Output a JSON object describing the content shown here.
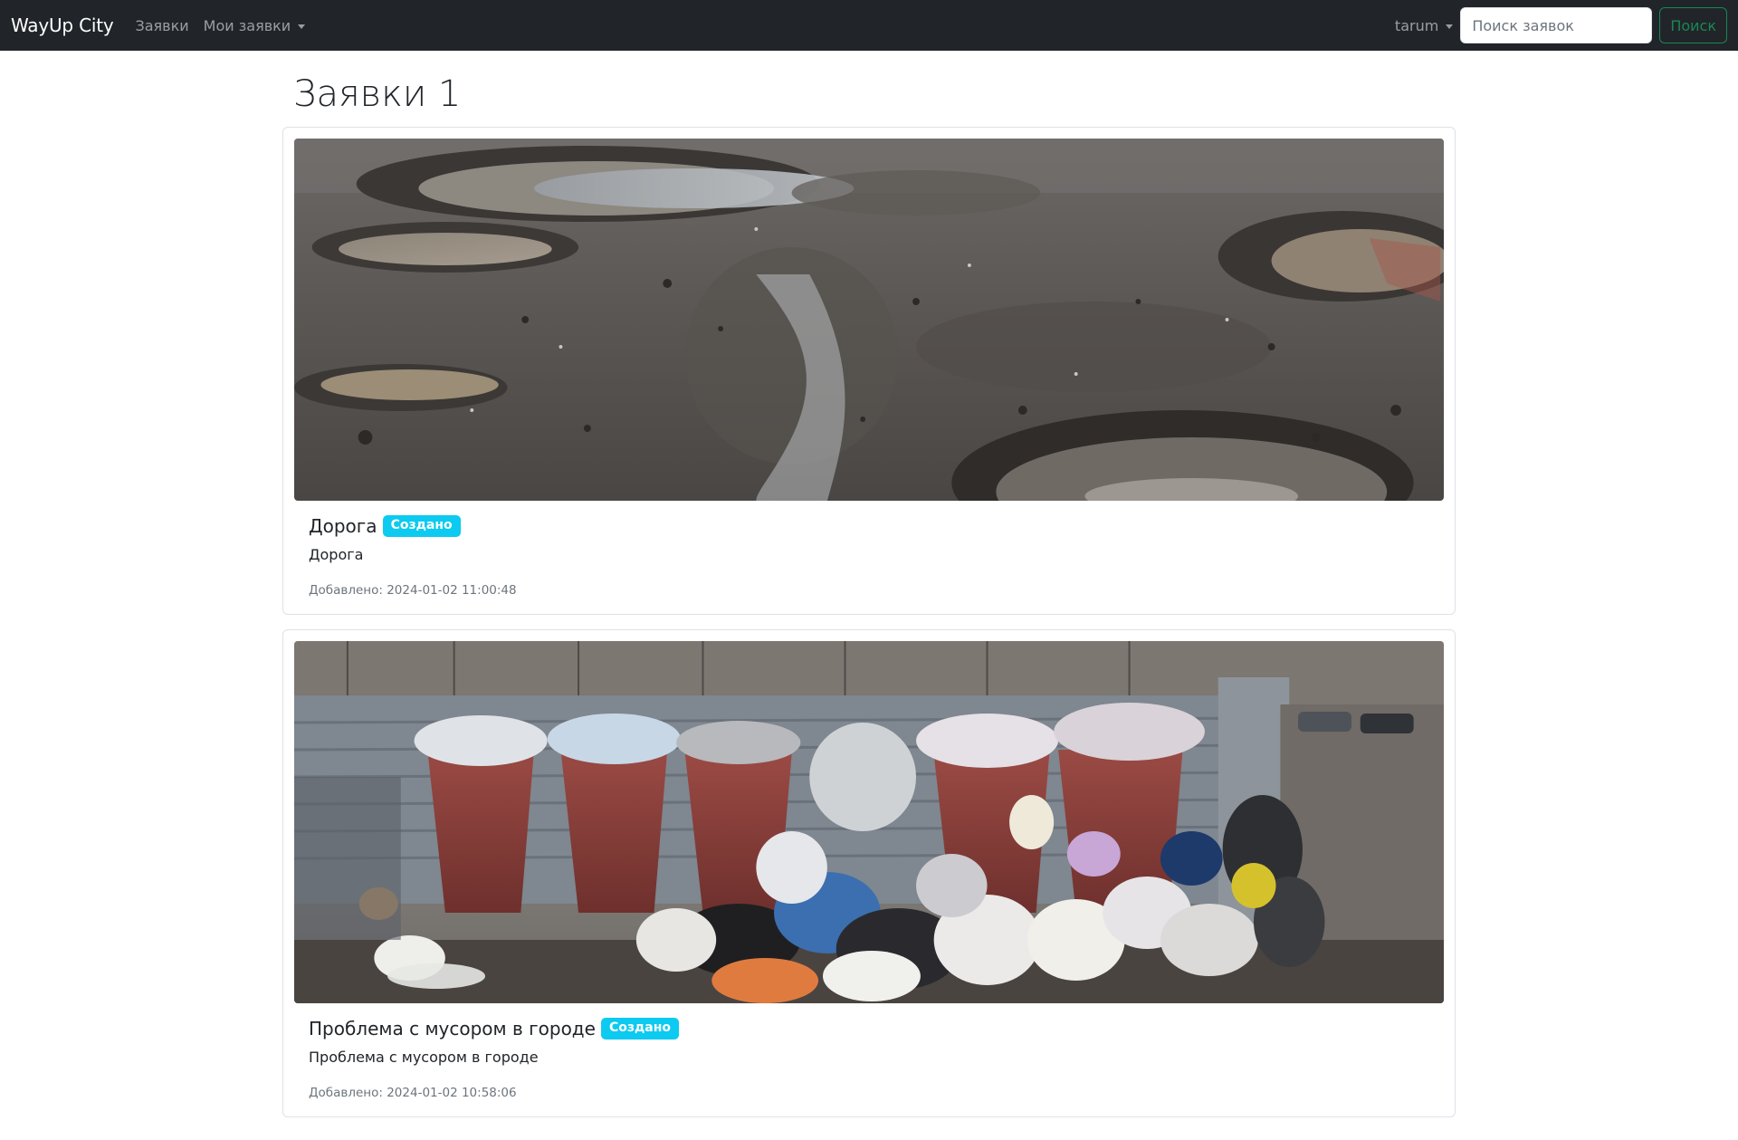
{
  "navbar": {
    "brand": "WayUp City",
    "links": [
      {
        "label": "Заявки"
      },
      {
        "label": "Мои заявки"
      }
    ],
    "user": "tarum",
    "search": {
      "placeholder": "Поиск заявок",
      "value": "",
      "button_label": "Поиск"
    }
  },
  "page": {
    "title": "Заявки 1"
  },
  "requests": [
    {
      "title": "Дорога",
      "status": "Создано",
      "description": "Дорога",
      "added": "Добавлено: 2024-01-02 11:00:48",
      "image": "road-potholes-photo"
    },
    {
      "title": "Проблема с мусором в городе",
      "status": "Создано",
      "description": "Проблема с мусором в городе",
      "added": "Добавлено: 2024-01-02 10:58:06",
      "image": "garbage-containers-photo"
    }
  ],
  "colors": {
    "navbar_bg": "#212529",
    "badge": "#0dcaf0",
    "search_button": "#198754"
  }
}
